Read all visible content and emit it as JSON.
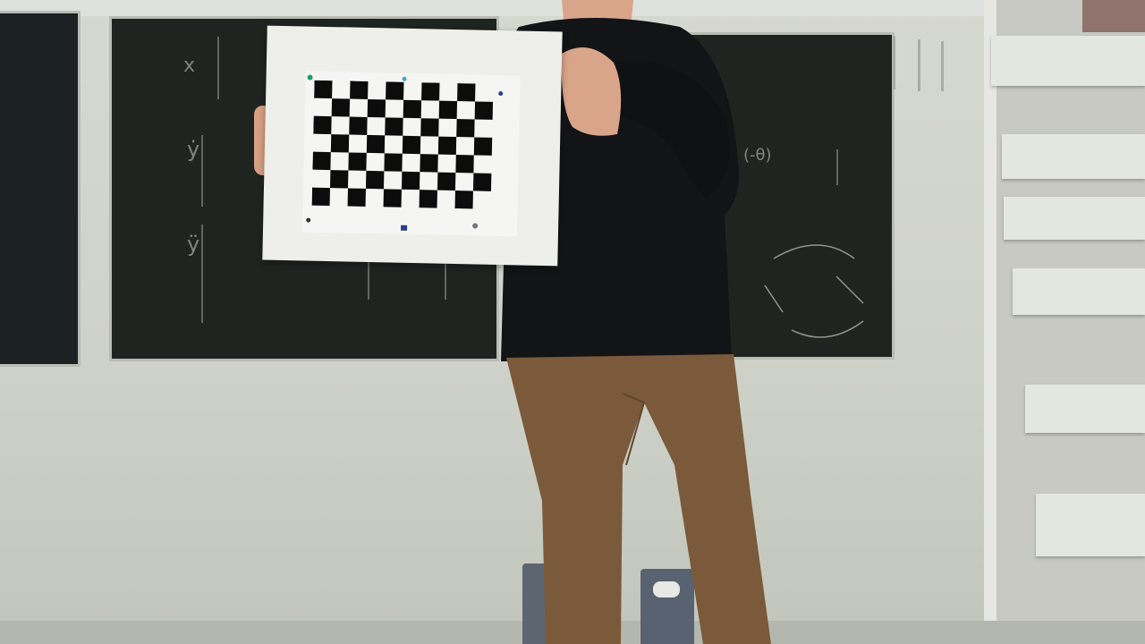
{
  "scene": {
    "description_tags": [
      "classroom",
      "chalkboard",
      "person",
      "calibration-checkerboard",
      "shelves",
      "trash-bins"
    ]
  },
  "checkerboard": {
    "columns": 10,
    "rows": 7,
    "dark_color": "#0c0c0c",
    "light_color": "#f5f5f3",
    "frame_color": "#eeeeea",
    "marker_colors": [
      "#1aa06a",
      "#2c3f8f",
      "#4aa7c2",
      "#777777"
    ]
  },
  "colors": {
    "wall": "#cfd2c8",
    "chalkboard": "#1f2420",
    "sweater": "#121416",
    "trousers": "#7a5a3a",
    "skin": "#d9a58a"
  }
}
